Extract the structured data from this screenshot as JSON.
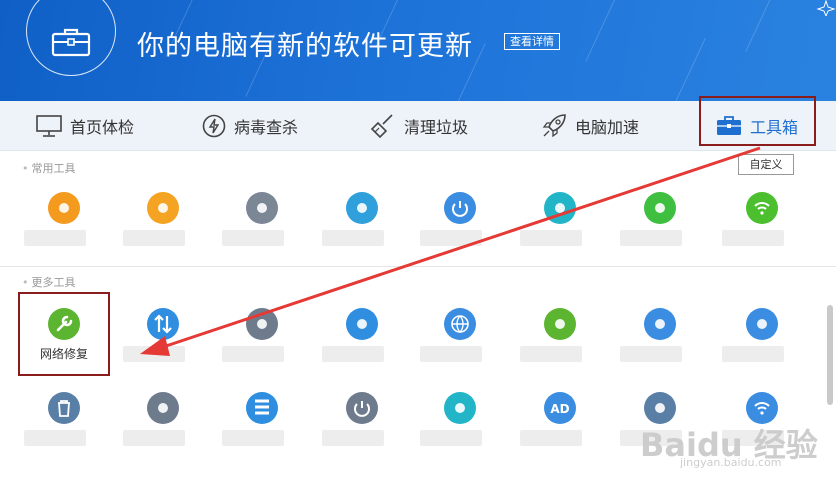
{
  "header": {
    "headline": "你的电脑有新的软件可更新",
    "details_button": "查看详情"
  },
  "nav": {
    "items": [
      {
        "label": "首页体检",
        "icon": "monitor-icon"
      },
      {
        "label": "病毒查杀",
        "icon": "lightning-shield-icon"
      },
      {
        "label": "清理垃圾",
        "icon": "broom-icon"
      },
      {
        "label": "电脑加速",
        "icon": "rocket-icon"
      },
      {
        "label": "工具箱",
        "icon": "toolbox-icon",
        "active": true
      }
    ]
  },
  "common_tools": {
    "title": "常用工具",
    "customize_button": "自定义",
    "tools": [
      {
        "icon": "clover-icon",
        "color": "#f39a1f"
      },
      {
        "icon": "stethoscope-icon",
        "color": "#f4a322"
      },
      {
        "icon": "refresh-globe-icon",
        "color": "#7c8796"
      },
      {
        "icon": "swirl-icon",
        "color": "#2fa0dc"
      },
      {
        "icon": "power-dial-icon",
        "color": "#3a8de0"
      },
      {
        "icon": "chip-search-icon",
        "color": "#22b5c8"
      },
      {
        "icon": "green-doc-icon",
        "color": "#3fbf3f"
      },
      {
        "icon": "wifi-shield-icon",
        "color": "#4cbf2f"
      }
    ]
  },
  "more_tools": {
    "title": "更多工具",
    "tools": [
      {
        "icon": "wrench-icon",
        "color": "#5cb531",
        "label": "网络修复"
      },
      {
        "icon": "up-down-arrows-icon",
        "color": "#2f8ee0"
      },
      {
        "icon": "broom-clean-icon",
        "color": "#6d7b8c"
      },
      {
        "icon": "chevron-shield-icon",
        "color": "#2f8ee0"
      },
      {
        "icon": "globe-icon",
        "color": "#3a8de0"
      },
      {
        "icon": "firewall-icon",
        "color": "#5cb531"
      },
      {
        "icon": "ie-icon",
        "color": "#3a8de0"
      },
      {
        "icon": "rocket-circle-icon",
        "color": "#3a8de0"
      },
      {
        "icon": "trash-icon",
        "color": "#5a7fa6"
      },
      {
        "icon": "puzzle-icon",
        "color": "#6d7b8c"
      },
      {
        "icon": "server-icon",
        "color": "#2f8ee0"
      },
      {
        "icon": "speed-dial-icon",
        "color": "#6d7b8c"
      },
      {
        "icon": "shredder-icon",
        "color": "#22b5c8"
      },
      {
        "icon": "ad-block-icon",
        "color": "#3a8de0"
      },
      {
        "icon": "eraser-icon",
        "color": "#5a7fa6"
      },
      {
        "icon": "wifi-circle-icon",
        "color": "#3a8de0"
      }
    ]
  },
  "watermark": {
    "text": "Baidu 经验",
    "sub": "jingyan.baidu.com"
  },
  "colors": {
    "header_bg": "#1d72d8",
    "accent": "#1e6fd0",
    "highlight_frame": "#8b1c1c",
    "arrow": "#e53935"
  }
}
